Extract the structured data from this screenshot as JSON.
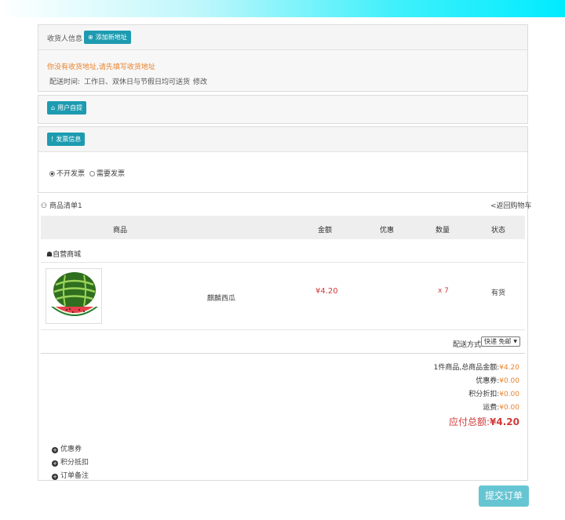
{
  "address": {
    "label": "收货人信息",
    "add_button": "添加新地址",
    "warning": "你没有收货地址,请先填写收货地址",
    "delivery_time_label": "配送时间:",
    "delivery_time_value": "工作日、双休日与节假日均可送货",
    "modify": "修改"
  },
  "pickup": {
    "button": "用户自提"
  },
  "invoice": {
    "button": "发票信息",
    "options": [
      "不开发票",
      "需要发票"
    ]
  },
  "goods": {
    "title": "商品清单1",
    "back_link": "<返回购物车",
    "columns": [
      "商品",
      "金额",
      "优惠",
      "数量",
      "状态"
    ],
    "shop": "自营商城",
    "item": {
      "name": "麒麟西瓜",
      "price": "¥4.20",
      "discount": "",
      "qty": "x 7",
      "status": "有货"
    },
    "shipping_label": "配送方式:",
    "shipping_value": "快递 免邮"
  },
  "summary": {
    "goods_total_label": "1件商品,总商品金额:",
    "goods_total": "¥4.20",
    "coupon_label": "优惠券:",
    "coupon": "¥0.00",
    "points_label": "积分折扣:",
    "points": "¥0.00",
    "freight_label": "运费:",
    "freight": "¥0.00",
    "pay_label": "应付总额:",
    "pay": "¥4.20"
  },
  "extras": [
    "优惠券",
    "积分抵扣",
    "订单备注"
  ],
  "submit": "提交订单",
  "colors": {
    "accent": "#1d9bb0",
    "orange": "#e9832d",
    "red": "#d13a3a"
  }
}
